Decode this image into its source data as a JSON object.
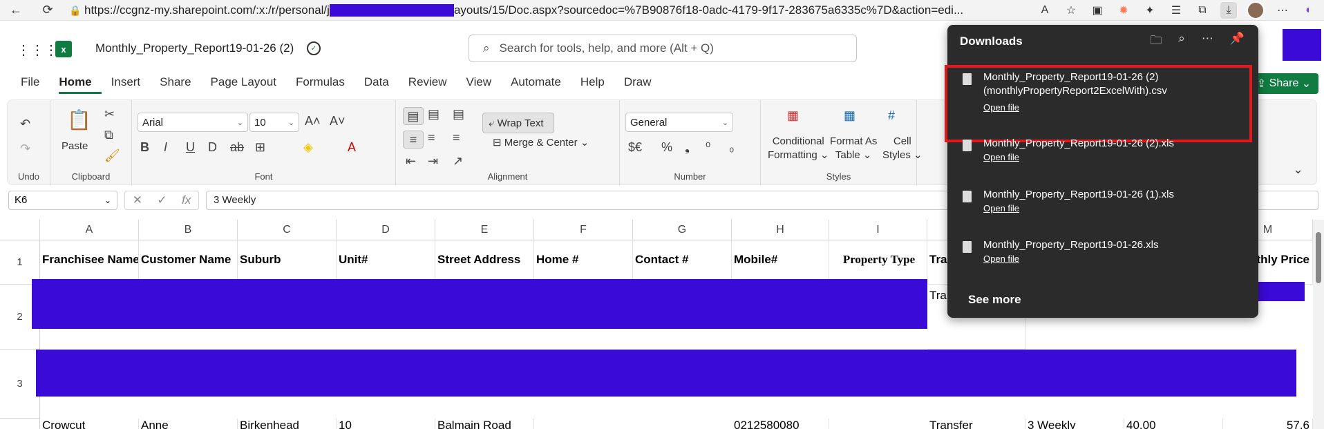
{
  "browser": {
    "url_prefix": "https://ccgnz-my.sharepoint.com/:x:/r/personal/j",
    "url_suffix": "ayouts/15/Doc.aspx?sourcedoc=%7B90876f18-0adc-4179-9f17-283675a6335c%7D&action=edi..."
  },
  "app": {
    "title": "Monthly_Property_Report19-01-26 (2)",
    "search_placeholder": "Search for tools, help, and more (Alt + Q)",
    "share_label": "Share"
  },
  "tabs": [
    "File",
    "Home",
    "Insert",
    "Share",
    "Page Layout",
    "Formulas",
    "Data",
    "Review",
    "View",
    "Automate",
    "Help",
    "Draw"
  ],
  "ribbon": {
    "undo_label": "Undo",
    "clipboard_label": "Clipboard",
    "paste_label": "Paste",
    "font_label": "Font",
    "font_name": "Arial",
    "font_size": "10",
    "alignment_label": "Alignment",
    "wrap_text": "Wrap Text",
    "merge_center": "Merge & Center",
    "number_label": "Number",
    "number_format": "General",
    "styles_label": "Styles",
    "conditional_formatting": [
      "Conditional",
      "Formatting"
    ],
    "format_as_table": [
      "Format As",
      "Table"
    ],
    "cell_styles": [
      "Cell",
      "Styles"
    ]
  },
  "formula_bar": {
    "cell_ref": "K6",
    "value": "3 Weekly"
  },
  "columns": [
    "A",
    "B",
    "C",
    "D",
    "E",
    "F",
    "G",
    "H",
    "I",
    "M"
  ],
  "rows": [
    "1",
    "2",
    "3"
  ],
  "header_row": {
    "A": "Franchisee Name",
    "B": "Customer Name",
    "C": "Suburb",
    "D": "Unit#",
    "E": "Street Address",
    "F": "Home #",
    "G": "Contact #",
    "H": "Mobile#",
    "I": "Property Type",
    "J": "Tra",
    "M": "thly Price"
  },
  "row2_partial": "Tra",
  "bottom_row": {
    "A": "Crowcut",
    "B": "Anne",
    "C": "Birkenhead",
    "D": "10",
    "E": "Balmain Road",
    "H": "0212580080",
    "J": "Transfer",
    "K": "3 Weekly",
    "L": "40.00",
    "M": "57.6"
  },
  "downloads": {
    "title": "Downloads",
    "items": [
      {
        "name_line1": "Monthly_Property_Report19-01-26 (2)",
        "name_line2": "(monthlyPropertyReport2ExcelWith).csv",
        "action": "Open file"
      },
      {
        "name_line1": "Monthly_Property_Report19-01-26 (2).xls",
        "action": "Open file"
      },
      {
        "name_line1": "Monthly_Property_Report19-01-26 (1).xls",
        "action": "Open file"
      },
      {
        "name_line1": "Monthly_Property_Report19-01-26.xls",
        "action": "Open file"
      }
    ],
    "see_more": "See more"
  },
  "colors": {
    "excel_green": "#107c41",
    "redaction": "#3a0ad6",
    "highlight_red": "#e0191c",
    "panel_bg": "#2b2b2b"
  }
}
